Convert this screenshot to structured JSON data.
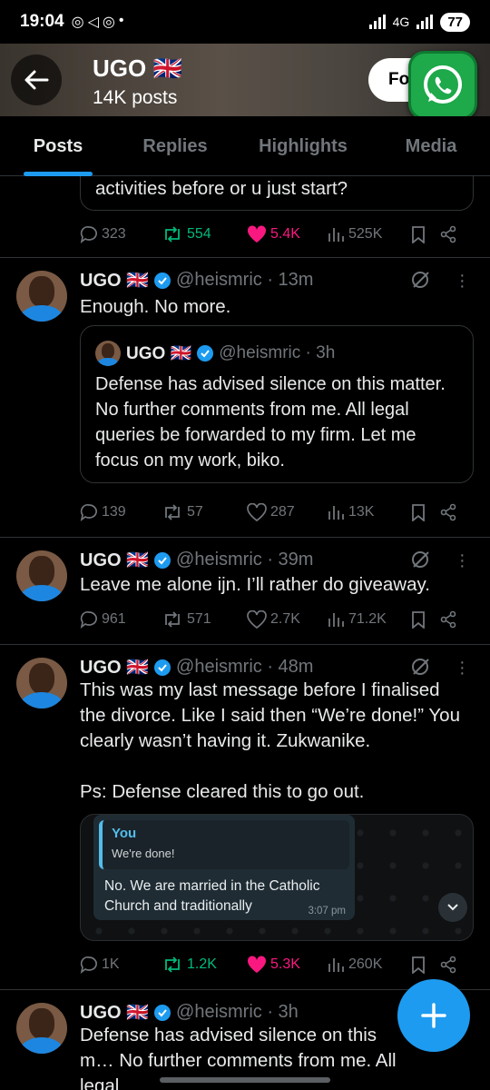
{
  "status_bar": {
    "time": "19:04",
    "network": "4G",
    "battery": "77",
    "left_icons": [
      "whatsapp-icon",
      "telegram-icon",
      "whatsapp-icon",
      "dot"
    ]
  },
  "header": {
    "title": "UGO 🇬🇧",
    "posts_count": "14K posts",
    "follow_label": "Fo"
  },
  "tabs": [
    {
      "label": "Posts",
      "active": true
    },
    {
      "label": "Replies",
      "active": false
    },
    {
      "label": "Highlights",
      "active": false
    },
    {
      "label": "Media",
      "active": false
    }
  ],
  "tweets": [
    {
      "text": "activities before or u just start?",
      "stats": {
        "replies": "323",
        "reposts": "554",
        "likes": "5.4K",
        "views": "525K"
      }
    },
    {
      "name": "UGO 🇬🇧",
      "handle": "@heismric · 13m",
      "text": "Enough. No more.",
      "quote": {
        "name": "UGO 🇬🇧",
        "handle": "@heismric · 3h",
        "text": "Defense has advised silence on this matter. No further comments from me. All legal queries be forwarded to my firm. Let me focus on my work, biko."
      },
      "stats": {
        "replies": "139",
        "reposts": "57",
        "likes": "287",
        "views": "13K"
      }
    },
    {
      "name": "UGO 🇬🇧",
      "handle": "@heismric · 39m",
      "text": "Leave me alone ijn. I’ll rather do giveaway.",
      "stats": {
        "replies": "961",
        "reposts": "571",
        "likes": "2.7K",
        "views": "71.2K"
      }
    },
    {
      "name": "UGO 🇬🇧",
      "handle": "@heismric · 48m",
      "text": "This was my last message before I finalised the divorce. Like I said then “We’re done!” You clearly wasn’t having it. Zukwanike.",
      "text2": "Ps: Defense cleared this to go out.",
      "image": {
        "reply_to": "You",
        "reply_msg": "We're done!",
        "message": "No. We are married in the Catholic Church and traditionally",
        "time": "3:07 pm"
      },
      "stats": {
        "replies": "1K",
        "reposts": "1.2K",
        "likes": "5.3K",
        "views": "260K"
      }
    },
    {
      "name": "UGO 🇬🇧",
      "handle": "@heismric · 3h",
      "text": "Defense has advised silence on this m… No further comments from me. All legal"
    }
  ],
  "colors": {
    "accent": "#1d9bf0",
    "repost_active": "#00ba7c",
    "like_active": "#f91880",
    "muted": "#71767b"
  }
}
